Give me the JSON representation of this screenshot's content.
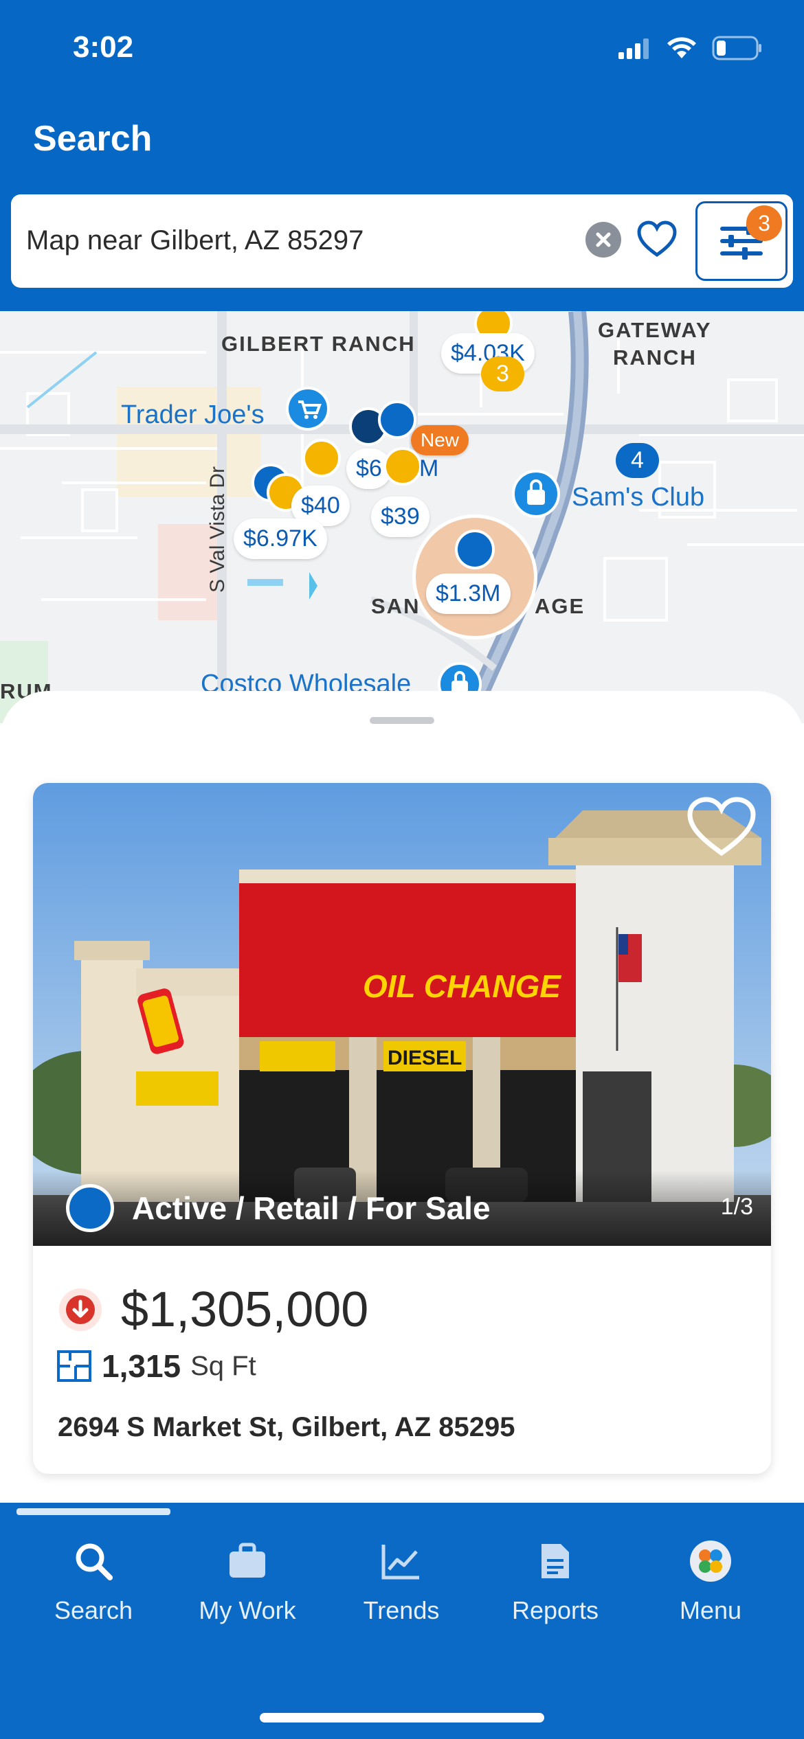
{
  "status_bar": {
    "time": "3:02"
  },
  "header": {
    "title": "Search"
  },
  "search": {
    "query": "Map near Gilbert, AZ 85297",
    "filter_count": "3"
  },
  "map": {
    "area_labels": [
      "GILBERT RANCH",
      "GATEWAY",
      "RANCH",
      "SAN",
      "AGE",
      "RUM"
    ],
    "road_label": "S Val Vista Dr",
    "pois": [
      "Trader Joe's",
      "Sam's Club",
      "Costco Wholesale"
    ],
    "prices": [
      "$4.03K",
      "$6",
      "M",
      "$40",
      "$39",
      "$6.97K",
      "$1.3M"
    ],
    "clusters": [
      "3",
      "4"
    ],
    "new_badge": "New"
  },
  "listing": {
    "status": "Active / Retail / For Sale",
    "photo_index": "1/3",
    "price": "$1,305,000",
    "size_value": "1,315",
    "size_unit": "Sq Ft",
    "address": "2694 S Market St, Gilbert, AZ 85295",
    "sign_text": "OIL CHANGE",
    "sign_text_2": "DIESEL"
  },
  "tabs": [
    {
      "label": "Search",
      "icon": "search-icon"
    },
    {
      "label": "My Work",
      "icon": "briefcase-icon"
    },
    {
      "label": "Trends",
      "icon": "trends-icon"
    },
    {
      "label": "Reports",
      "icon": "reports-icon"
    },
    {
      "label": "Menu",
      "icon": "menu-icon"
    }
  ],
  "colors": {
    "brand_blue": "#0667c5",
    "accent_orange": "#f07a22",
    "pin_yellow": "#f4b400"
  }
}
